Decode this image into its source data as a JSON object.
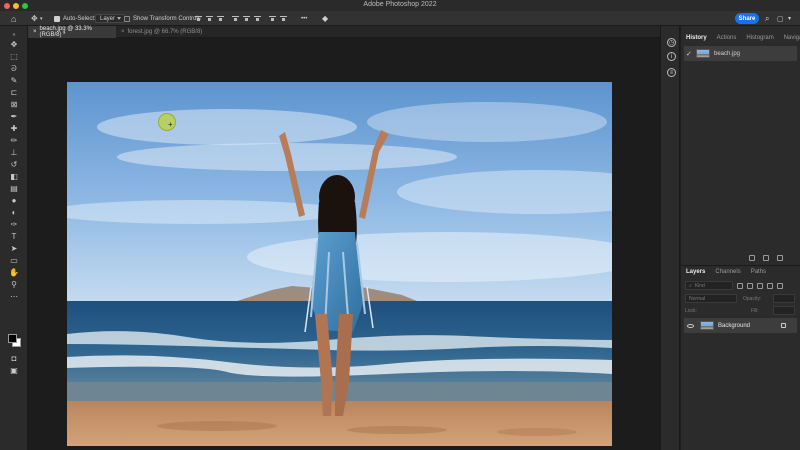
{
  "app_title": "Adobe Photoshop 2022",
  "options_bar": {
    "auto_select_label": "Auto-Select:",
    "auto_select_checked": true,
    "auto_select_target": "Layer",
    "show_transform_label": "Show Transform Controls",
    "show_transform_checked": false,
    "more_label": "•••",
    "share_label": "Share"
  },
  "tabs": [
    {
      "label": "beach.jpg @ 33.3% (RGB/8) *",
      "active": true
    },
    {
      "label": "forest.jpg @ 66.7% (RGB/8)",
      "active": false
    }
  ],
  "history_panel": {
    "tabs": [
      "History",
      "Actions",
      "Histogram",
      "Navigator"
    ],
    "entries": [
      {
        "label": "beach.jpg"
      }
    ]
  },
  "layers_panel": {
    "tabs": [
      "Layers",
      "Channels",
      "Paths"
    ],
    "kind_placeholder": "Kind",
    "blend_mode": "Normal",
    "opacity_label": "Opacity:",
    "lock_label": "Lock:",
    "fill_label": "Fill:",
    "layers": [
      {
        "name": "Background",
        "visible": true,
        "locked": true
      }
    ]
  },
  "colors": {
    "accent": "#1473e6",
    "brush_cursor": "#bed23c",
    "foreground_swatch": "#000000",
    "background_swatch": "#ffffff"
  }
}
